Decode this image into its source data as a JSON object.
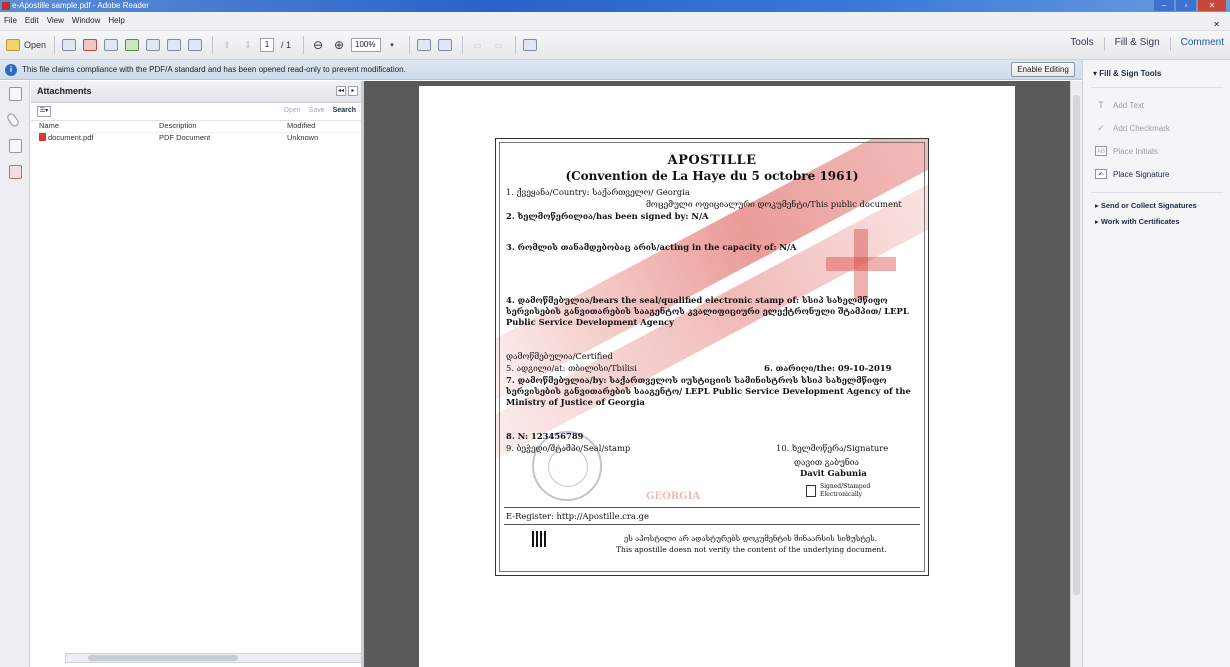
{
  "window": {
    "title": "e-Apostille sample.pdf - Adobe Reader"
  },
  "menu": [
    "File",
    "Edit",
    "View",
    "Window",
    "Help"
  ],
  "toolbar": {
    "open_label": "Open",
    "page_current": "1",
    "page_total": "/ 1",
    "zoom": "100%"
  },
  "top_right": {
    "tools": "Tools",
    "fill_sign": "Fill & Sign",
    "comment": "Comment"
  },
  "infobar": {
    "message": "This file claims compliance with the PDF/A standard and has been opened read-only to prevent modification.",
    "enable_editing": "Enable Editing"
  },
  "attachments": {
    "title": "Attachments",
    "actions": {
      "open": "Open",
      "save": "Save",
      "search": "Search"
    },
    "columns": [
      "Name",
      "Description",
      "Modified"
    ],
    "rows": [
      {
        "name": "document.pdf",
        "description": "PDF Document",
        "modified": "Unknown"
      }
    ]
  },
  "certificate": {
    "title": "APOSTILLE",
    "subtitle": "(Convention de La Haye du 5 octobre 1961)",
    "line1": "1. ქვეყანა/Country: საქართველო/ Georgia",
    "line1b": "მოცემული ოფიციალური დოკუმენტი/This public document",
    "line2": "2. ხელმოწერილია/has been signed by: N/A",
    "line3": "3. რომლის თანამდებობაც არის/acting in the capacity of: N/A",
    "line4": "4. დამოწმებულია/bears the seal/qualified electronic stamp of: სსიპ სახელმწიფო სერვისების განვითარების სააგენტოს კვალიფიციური ელექტრონული შტამპით/ LEPL Public Service Development Agency",
    "certified": "დამოწმებულია/Certified",
    "line5": "5. ადგილი/at: თბილისი/Tbilisi",
    "line6": "6. თარიღი/the: 09-10-2019",
    "line7": "7. დამოწმებულია/by: საქართველოს იუსტიციის სამინისტროს სსიპ სახელმწიფო სერვისების განვითარების სააგენტო/ LEPL Public Service Development Agency of the Ministry of Justice of Georgia",
    "line8": "8. N: 123456789",
    "line9": "9. ბეჭედი/შტამპი/Seal/stamp",
    "line10": "10. ხელმოწერა/Signature",
    "signer_ka": "დავით გაბუნია",
    "signer_en": "Davit Gabunia",
    "signed_stamped": "Signed/Stamped Electronically",
    "watermark": "GEORGIA",
    "register": "E-Register: http://Apostille.cra.ge",
    "footer_ka": "ეს აპოსტილი არ ადასტურებს დოკუმენტის შინაარსის სიზუსტეს.",
    "footer_en": "This apostille doesn not verify the content of the underlying document."
  },
  "right_panel": {
    "header": "Fill & Sign Tools",
    "items": [
      "Add Text",
      "Add Checkmark",
      "Place Initials",
      "Place Signature"
    ],
    "sections": [
      "Send or Collect Signatures",
      "Work with Certificates"
    ]
  },
  "colors": {
    "accent": "#2059a8",
    "stamp_red": "#d63a34",
    "viewer_bg": "#5a5a5a"
  }
}
